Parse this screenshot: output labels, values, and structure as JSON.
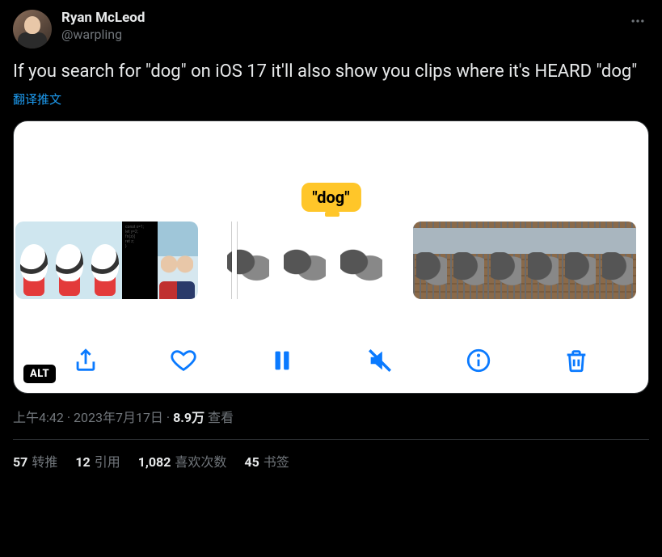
{
  "author": {
    "display_name": "Ryan McLeod",
    "handle": "@warpling"
  },
  "tweet_text": "If you search for \"dog\" on iOS 17 it'll also show you clips where it's HEARD \"dog\"",
  "translate_label": "翻译推文",
  "media": {
    "tooltip": "\"dog\"",
    "alt_badge": "ALT"
  },
  "meta": {
    "time": "上午4:42",
    "date": "2023年7月17日",
    "views_count": "8.9万",
    "views_label": "查看"
  },
  "engagement": {
    "retweets": {
      "count": "57",
      "label": "转推"
    },
    "quotes": {
      "count": "12",
      "label": "引用"
    },
    "likes": {
      "count": "1,082",
      "label": "喜欢次数"
    },
    "bookmarks": {
      "count": "45",
      "label": "书签"
    }
  }
}
